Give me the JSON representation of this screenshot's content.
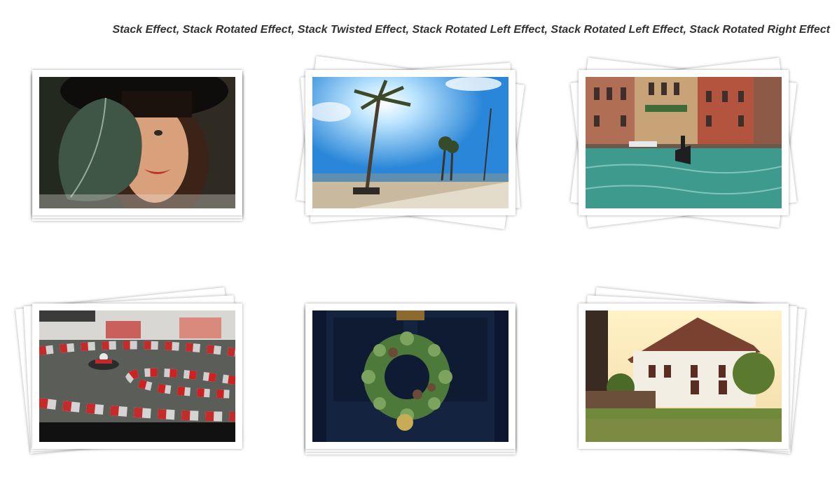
{
  "header": {
    "title": "Stack Effect, Stack Rotated Effect, Stack Twisted Effect, Stack Rotated Left Effect, Stack Rotated Left Effect, Stack Rotated Right Effect"
  },
  "gallery": {
    "items": [
      {
        "effect": "stack",
        "subject": "woman-with-leaf-photo"
      },
      {
        "effect": "stack-rotated",
        "subject": "palm-beach-photo"
      },
      {
        "effect": "stack-twisted",
        "subject": "venice-canal-photo"
      },
      {
        "effect": "stack-rotated-left",
        "subject": "go-kart-track-photo"
      },
      {
        "effect": "stack-rotated-left",
        "subject": "christmas-wreath-photo"
      },
      {
        "effect": "stack-rotated-right",
        "subject": "white-house-photo"
      }
    ]
  },
  "colors": {
    "background": "#ffffff",
    "title": "#333333",
    "card": "#ffffff"
  }
}
